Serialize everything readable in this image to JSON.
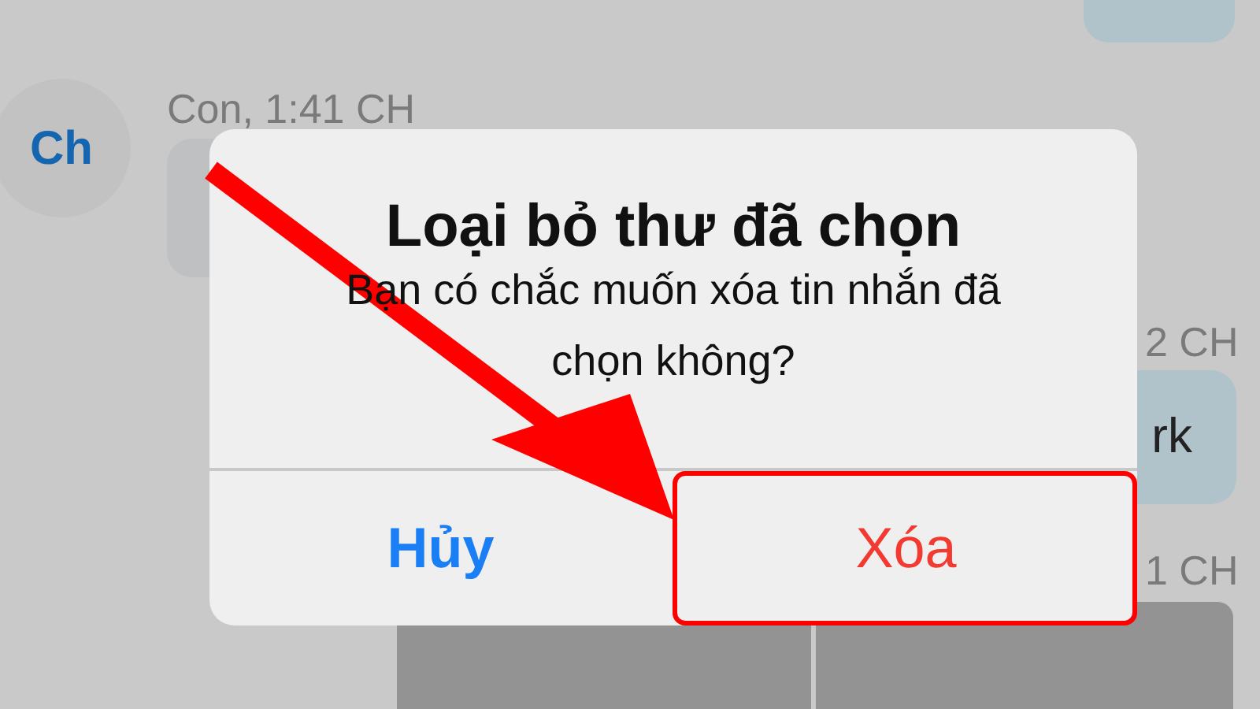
{
  "chat": {
    "incoming": {
      "avatar": "Ch",
      "sender_time": "Con, 1:41 CH"
    },
    "timestamps": [
      "2 CH",
      "1 CH"
    ],
    "outgoing_text": "rk"
  },
  "dialog": {
    "title": "Loại bỏ thư đã chọn",
    "message": "Bạn có chắc muốn xóa tin nhắn đã chọn không?",
    "buttons": [
      {
        "label": "Hủy",
        "kind": "cancel",
        "highlighted": false
      },
      {
        "label": "Xóa",
        "kind": "destructive",
        "highlighted": true
      }
    ]
  }
}
